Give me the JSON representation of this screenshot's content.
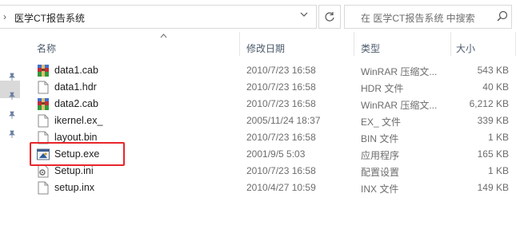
{
  "address": {
    "chevron": "›",
    "crumb": "医学CT报告系统"
  },
  "search": {
    "placeholder": "在 医学CT报告系统 中搜索"
  },
  "columns": {
    "name": "名称",
    "date": "修改日期",
    "type": "类型",
    "size": "大小"
  },
  "files": [
    {
      "name": "data1.cab",
      "date": "2010/7/23 16:58",
      "type": "WinRAR 压缩文...",
      "size": "543 KB",
      "icon": "winrar-archive-icon"
    },
    {
      "name": "data1.hdr",
      "date": "2010/7/23 16:58",
      "type": "HDR 文件",
      "size": "40 KB",
      "icon": "document-file-icon"
    },
    {
      "name": "data2.cab",
      "date": "2010/7/23 16:58",
      "type": "WinRAR 压缩文...",
      "size": "6,212 KB",
      "icon": "winrar-archive-icon"
    },
    {
      "name": "ikernel.ex_",
      "date": "2005/11/24 18:37",
      "type": "EX_ 文件",
      "size": "339 KB",
      "icon": "document-file-icon"
    },
    {
      "name": "layout.bin",
      "date": "2010/7/23 16:58",
      "type": "BIN 文件",
      "size": "1 KB",
      "icon": "document-file-icon"
    },
    {
      "name": "Setup.exe",
      "date": "2001/9/5 5:03",
      "type": "应用程序",
      "size": "165 KB",
      "icon": "setup-application-icon"
    },
    {
      "name": "Setup.ini",
      "date": "2010/7/23 16:58",
      "type": "配置设置",
      "size": "1 KB",
      "icon": "config-settings-icon"
    },
    {
      "name": "setup.inx",
      "date": "2010/4/27 10:59",
      "type": "INX 文件",
      "size": "149 KB",
      "icon": "document-file-icon"
    }
  ],
  "colors": {
    "highlight": "#e8262b",
    "header_text": "#4c5a6b",
    "meta_text": "#6d6d6d"
  }
}
